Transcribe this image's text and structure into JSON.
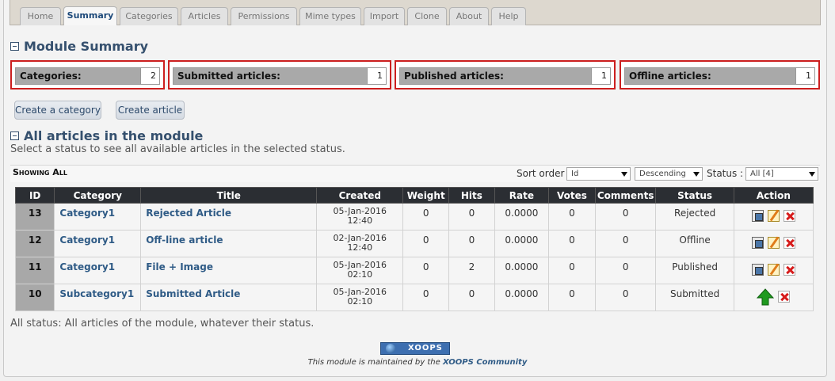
{
  "tabs": [
    "Home",
    "Summary",
    "Categories",
    "Articles",
    "Permissions",
    "Mime types",
    "Import",
    "Clone",
    "About",
    "Help"
  ],
  "active_tab": "Summary",
  "module_summary": {
    "title": "Module Summary",
    "stats": [
      {
        "label": "Categories:",
        "count": "2"
      },
      {
        "label": "Submitted articles:",
        "count": "1"
      },
      {
        "label": "Published articles:",
        "count": "1"
      },
      {
        "label": "Offline articles:",
        "count": "1"
      }
    ]
  },
  "buttons": {
    "create_category": "Create a category",
    "create_article": "Create article"
  },
  "articles_section": {
    "title": "All articles in the module",
    "intro": "Select a status to see all available articles in the selected status.",
    "showing": "Showing All",
    "sort_order_label": "Sort order",
    "sort_field": "Id",
    "sort_direction": "Descending",
    "status_label": "Status :",
    "status_value": "All [4]",
    "columns": [
      "ID",
      "Category",
      "Title",
      "Created",
      "Weight",
      "Hits",
      "Rate",
      "Votes",
      "Comments",
      "Status",
      "Action"
    ],
    "rows": [
      {
        "id": "13",
        "category": "Category1",
        "title": "Rejected Article",
        "date": "05-Jan-2016",
        "time": "12:40",
        "weight": "0",
        "hits": "0",
        "rate": "0.0000",
        "votes": "0",
        "comments": "0",
        "status": "Rejected",
        "actions": [
          "clone-icon",
          "edit-icon",
          "delete-icon"
        ]
      },
      {
        "id": "12",
        "category": "Category1",
        "title": "Off-line article",
        "date": "02-Jan-2016",
        "time": "12:40",
        "weight": "0",
        "hits": "0",
        "rate": "0.0000",
        "votes": "0",
        "comments": "0",
        "status": "Offline",
        "actions": [
          "clone-icon",
          "edit-icon",
          "delete-icon"
        ]
      },
      {
        "id": "11",
        "category": "Category1",
        "title": "File + Image",
        "date": "05-Jan-2016",
        "time": "02:10",
        "weight": "0",
        "hits": "2",
        "rate": "0.0000",
        "votes": "0",
        "comments": "0",
        "status": "Published",
        "actions": [
          "clone-icon",
          "edit-icon",
          "delete-icon"
        ]
      },
      {
        "id": "10",
        "category": "Subcategory1",
        "title": "Submitted Article",
        "date": "05-Jan-2016",
        "time": "02:10",
        "weight": "0",
        "hits": "0",
        "rate": "0.0000",
        "votes": "0",
        "comments": "0",
        "status": "Submitted",
        "actions": [
          "approve-icon",
          "delete-icon"
        ]
      }
    ],
    "footer_note": "All status: All articles of the module, whatever their status."
  },
  "footer": {
    "badge_text": "XOOPS",
    "maintained_prefix": "This module is maintained by the",
    "maintained_link": "XOOPS Community"
  },
  "colors": {
    "highlight_border": "#cc1f1f",
    "header_dark": "#2b2e33",
    "link": "#2f5b86",
    "approve_green": "#1f9a1f",
    "delete_red": "#d61c1c"
  }
}
